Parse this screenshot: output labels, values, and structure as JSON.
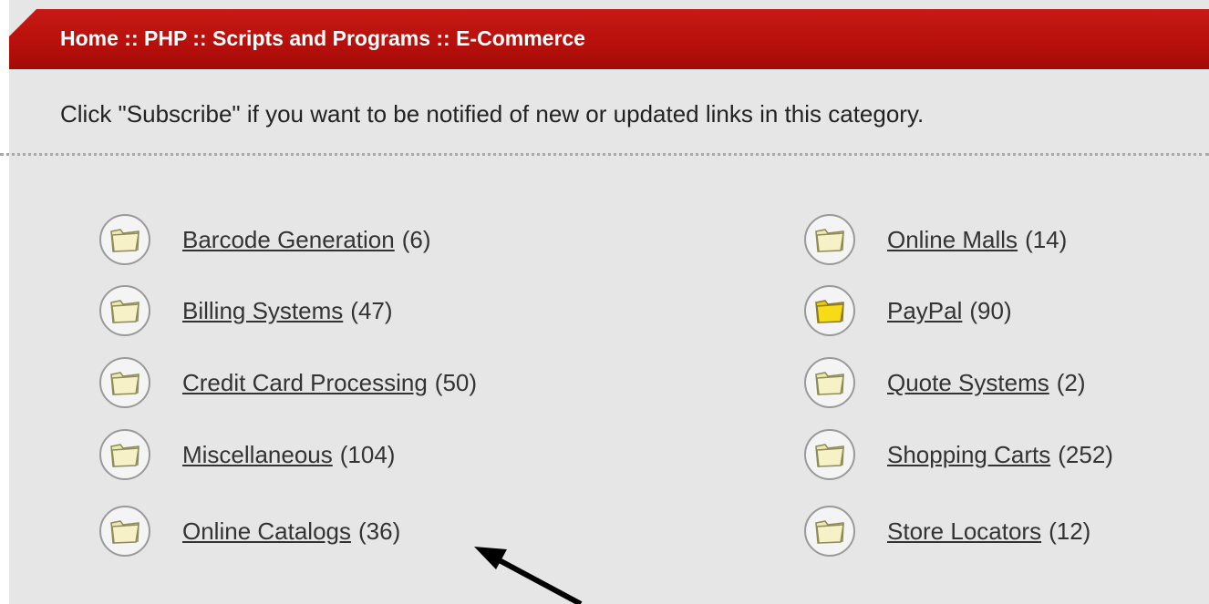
{
  "breadcrumb": {
    "text": "Home :: PHP :: Scripts and Programs :: E-Commerce"
  },
  "notice": {
    "text": "Click \"Subscribe\" if you want to be notified of new or updated links in this category."
  },
  "categories": {
    "left": [
      {
        "label": "Barcode Generation",
        "count": "(6)"
      },
      {
        "label": "Billing Systems",
        "count": "(47)"
      },
      {
        "label": "Credit Card Processing",
        "count": "(50)"
      },
      {
        "label": "Miscellaneous",
        "count": "(104)"
      },
      {
        "label": "Online Catalogs",
        "count": "(36)"
      }
    ],
    "right": [
      {
        "label": "Online Malls",
        "count": "(14)"
      },
      {
        "label": "PayPal",
        "count": "(90)",
        "highlight": true
      },
      {
        "label": "Quote Systems",
        "count": "(2)"
      },
      {
        "label": "Shopping Carts",
        "count": "(252)"
      },
      {
        "label": "Store Locators",
        "count": "(12)"
      }
    ]
  },
  "icons": {
    "category": "folder-icon",
    "annotation": "arrow-icon"
  },
  "colors": {
    "header": "#b8100c",
    "panel": "#e6e6e6",
    "folder": "#efe9b0",
    "folder_highlight": "#f5dc16"
  }
}
